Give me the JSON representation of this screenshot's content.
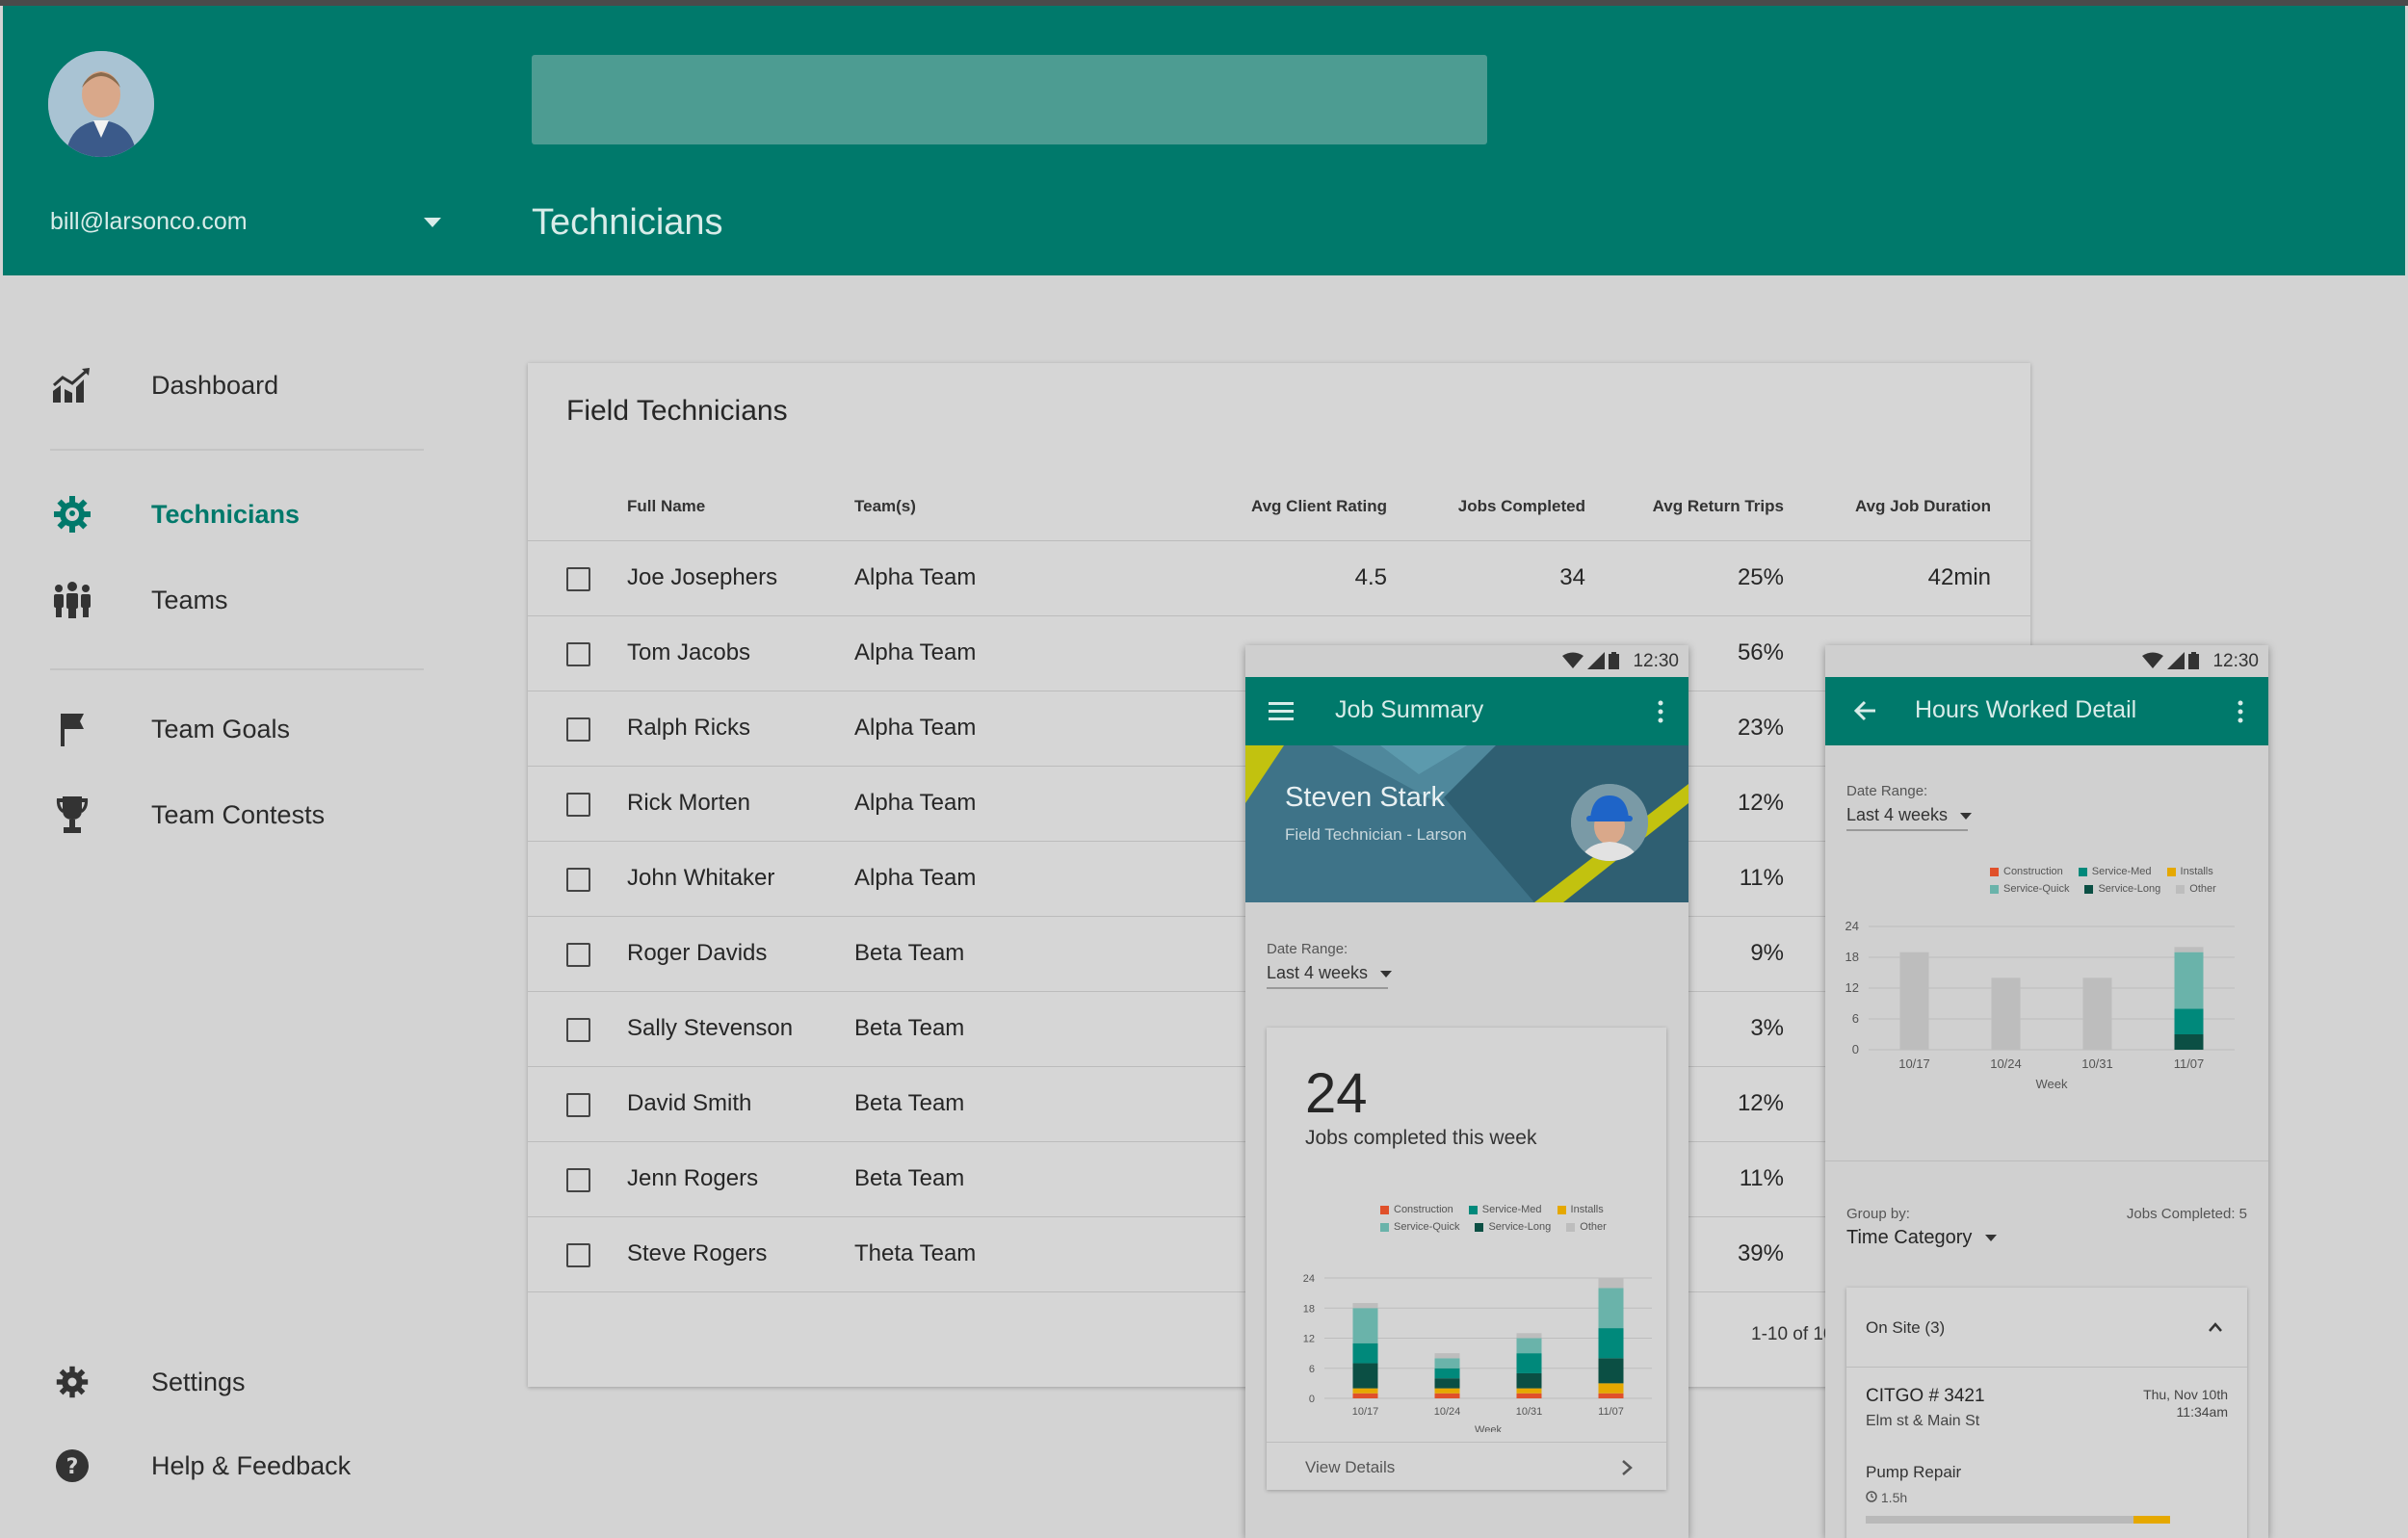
{
  "header": {
    "email": "bill@larsonco.com",
    "page_title": "Technicians"
  },
  "sidebar": {
    "items": [
      {
        "label": "Dashboard",
        "icon": "trending-chart-icon"
      },
      {
        "label": "Technicians",
        "icon": "gear-active-icon"
      },
      {
        "label": "Teams",
        "icon": "people-group-icon"
      },
      {
        "label": "Team Goals",
        "icon": "flag-icon"
      },
      {
        "label": "Team Contests",
        "icon": "trophy-icon"
      },
      {
        "label": "Settings",
        "icon": "gear-icon"
      },
      {
        "label": "Help & Feedback",
        "icon": "help-icon"
      }
    ]
  },
  "table": {
    "title": "Field Technicians",
    "columns": [
      "Full Name",
      "Team(s)",
      "Avg Client Rating",
      "Jobs Completed",
      "Avg Return Trips",
      "Avg Job Duration"
    ],
    "rows": [
      {
        "name": "Joe Josephers",
        "team": "Alpha Team",
        "rating": "4.5",
        "jobs": "34",
        "returns": "25%",
        "duration": "42min"
      },
      {
        "name": "Tom Jacobs",
        "team": "Alpha Team",
        "rating": "",
        "jobs": "",
        "returns": "56%",
        "duration": ""
      },
      {
        "name": "Ralph Ricks",
        "team": "Alpha Team",
        "rating": "",
        "jobs": "",
        "returns": "23%",
        "duration": ""
      },
      {
        "name": "Rick Morten",
        "team": "Alpha Team",
        "rating": "",
        "jobs": "",
        "returns": "12%",
        "duration": ""
      },
      {
        "name": "John Whitaker",
        "team": "Alpha Team",
        "rating": "",
        "jobs": "",
        "returns": "11%",
        "duration": ""
      },
      {
        "name": "Roger Davids",
        "team": "Beta Team",
        "rating": "",
        "jobs": "",
        "returns": "9%",
        "duration": ""
      },
      {
        "name": "Sally Stevenson",
        "team": "Beta Team",
        "rating": "",
        "jobs": "",
        "returns": "3%",
        "duration": ""
      },
      {
        "name": "David Smith",
        "team": "Beta Team",
        "rating": "",
        "jobs": "",
        "returns": "12%",
        "duration": ""
      },
      {
        "name": "Jenn Rogers",
        "team": "Beta Team",
        "rating": "",
        "jobs": "",
        "returns": "11%",
        "duration": ""
      },
      {
        "name": "Steve Rogers",
        "team": "Theta Team",
        "rating": "",
        "jobs": "",
        "returns": "39%",
        "duration": ""
      }
    ],
    "pagination": "1-10 of 10"
  },
  "phone_summary": {
    "time": "12:30",
    "title": "Job Summary",
    "tech_name": "Steven Stark",
    "tech_role": "Field Technician - Larson",
    "date_range_label": "Date Range:",
    "date_range_value": "Last 4 weeks",
    "big_number": "24",
    "big_caption": "Jobs completed this week",
    "legend": [
      "Construction",
      "Service-Med",
      "Installs",
      "Service-Quick",
      "Service-Long",
      "Other"
    ],
    "y_ticks": [
      "24",
      "18",
      "12",
      "6",
      "0"
    ],
    "x_ticks": [
      "10/17",
      "10/24",
      "10/31",
      "11/07"
    ],
    "x_axis_label": "Week",
    "view_details": "View Details"
  },
  "phone_hours": {
    "time": "12:30",
    "title": "Hours Worked Detail",
    "date_range_label": "Date Range:",
    "date_range_value": "Last 4 weeks",
    "legend": [
      "Construction",
      "Service-Med",
      "Installs",
      "Service-Quick",
      "Service-Long",
      "Other"
    ],
    "y_ticks": [
      "24",
      "18",
      "12",
      "6",
      "0"
    ],
    "x_ticks": [
      "10/17",
      "10/24",
      "10/31",
      "11/07"
    ],
    "x_axis_label": "Week",
    "group_by_label": "Group by:",
    "group_by_value": "Time Category",
    "jobs_completed": "Jobs Completed: 5",
    "section_title": "On Site (3)",
    "job_title": "CITGO # 3421",
    "job_address": "Elm st & Main St",
    "job_date": "Thu, Nov 10th",
    "job_time": "11:34am",
    "task": "Pump Repair",
    "task_duration": "1.5h"
  },
  "colors": {
    "primary": "#00796b",
    "construction": "#e0502a",
    "service_med": "#00897b",
    "installs": "#e5a800",
    "service_quick": "#6ab3aa",
    "service_long": "#0b4f44",
    "other": "#bdbdbd"
  },
  "chart_data": [
    {
      "type": "bar",
      "categories": [
        "10/17",
        "10/24",
        "10/31",
        "11/07"
      ],
      "series": [
        {
          "name": "Construction",
          "values": [
            1,
            1,
            1,
            1
          ]
        },
        {
          "name": "Installs",
          "values": [
            1,
            1,
            1,
            2
          ]
        },
        {
          "name": "Service-Long",
          "values": [
            5,
            2,
            3,
            5
          ]
        },
        {
          "name": "Service-Med",
          "values": [
            4,
            2,
            4,
            6
          ]
        },
        {
          "name": "Service-Quick",
          "values": [
            7,
            2,
            3,
            8
          ]
        },
        {
          "name": "Other",
          "values": [
            1,
            1,
            1,
            2
          ]
        }
      ],
      "xlabel": "Week",
      "ylim": [
        0,
        24
      ],
      "stacked": true
    },
    {
      "type": "bar",
      "categories": [
        "10/17",
        "10/24",
        "10/31",
        "11/07"
      ],
      "series": [
        {
          "name": "Service-Long",
          "values": [
            0,
            0,
            0,
            3
          ]
        },
        {
          "name": "Service-Med",
          "values": [
            0,
            0,
            0,
            5
          ]
        },
        {
          "name": "Service-Quick",
          "values": [
            0,
            0,
            0,
            11
          ]
        },
        {
          "name": "Other",
          "values": [
            19,
            14,
            14,
            1
          ]
        }
      ],
      "xlabel": "Week",
      "ylim": [
        0,
        24
      ],
      "stacked": true
    }
  ]
}
